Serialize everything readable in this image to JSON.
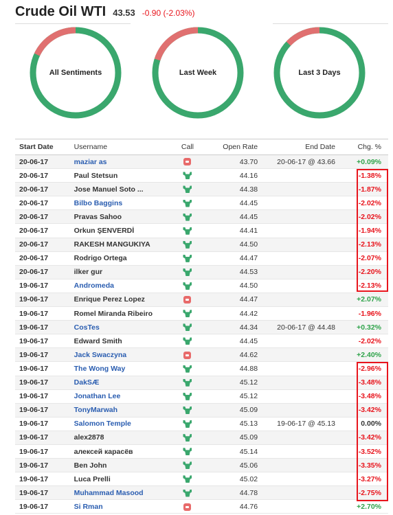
{
  "header": {
    "title": "Crude Oil WTI",
    "price": "43.53",
    "change": "-0.90 (-2.03%)"
  },
  "colors": {
    "bullish": "#3aa76d",
    "bearish": "#e07070",
    "negative": "#e8141c",
    "positive": "#2fa34a",
    "link": "#2a5db0"
  },
  "gauges": [
    {
      "label": "All Sentiments",
      "bearish_fraction": 0.18
    },
    {
      "label": "Last Week",
      "bearish_fraction": 0.2
    },
    {
      "label": "Last 3 Days",
      "bearish_fraction": 0.13
    }
  ],
  "table": {
    "headers": [
      "Start Date",
      "Username",
      "Call",
      "Open Rate",
      "End Date",
      "Chg. %"
    ],
    "rows": [
      {
        "date": "20-06-17",
        "user": "maziar as",
        "link": true,
        "call": "bearish",
        "rate": "43.70",
        "end": "20-06-17 @ 43.66",
        "chg": "+0.09%",
        "dir": "pos"
      },
      {
        "date": "20-06-17",
        "user": "Paul Stetsun",
        "link": false,
        "call": "bullish",
        "rate": "44.16",
        "end": "",
        "chg": "-1.38%",
        "dir": "neg"
      },
      {
        "date": "20-06-17",
        "user": "Jose Manuel Soto ...",
        "link": false,
        "call": "bullish",
        "rate": "44.38",
        "end": "",
        "chg": "-1.87%",
        "dir": "neg"
      },
      {
        "date": "20-06-17",
        "user": "Bilbo Baggins",
        "link": true,
        "call": "bullish",
        "rate": "44.45",
        "end": "",
        "chg": "-2.02%",
        "dir": "neg"
      },
      {
        "date": "20-06-17",
        "user": "Pravas Sahoo",
        "link": false,
        "call": "bullish",
        "rate": "44.45",
        "end": "",
        "chg": "-2.02%",
        "dir": "neg"
      },
      {
        "date": "20-06-17",
        "user": "Orkun ŞENVERDİ",
        "link": false,
        "call": "bullish",
        "rate": "44.41",
        "end": "",
        "chg": "-1.94%",
        "dir": "neg"
      },
      {
        "date": "20-06-17",
        "user": "RAKESH MANGUKIYA",
        "link": false,
        "call": "bullish",
        "rate": "44.50",
        "end": "",
        "chg": "-2.13%",
        "dir": "neg"
      },
      {
        "date": "20-06-17",
        "user": "Rodrigo Ortega",
        "link": false,
        "call": "bullish",
        "rate": "44.47",
        "end": "",
        "chg": "-2.07%",
        "dir": "neg"
      },
      {
        "date": "20-06-17",
        "user": "ilker gur",
        "link": false,
        "call": "bullish",
        "rate": "44.53",
        "end": "",
        "chg": "-2.20%",
        "dir": "neg"
      },
      {
        "date": "19-06-17",
        "user": "Andromeda",
        "link": true,
        "call": "bullish",
        "rate": "44.50",
        "end": "",
        "chg": "-2.13%",
        "dir": "neg"
      },
      {
        "date": "19-06-17",
        "user": "Enrique Perez Lopez",
        "link": false,
        "call": "bearish",
        "rate": "44.47",
        "end": "",
        "chg": "+2.07%",
        "dir": "pos"
      },
      {
        "date": "19-06-17",
        "user": "Romel Miranda Ribeiro",
        "link": false,
        "call": "bullish",
        "rate": "44.42",
        "end": "",
        "chg": "-1.96%",
        "dir": "neg"
      },
      {
        "date": "19-06-17",
        "user": "CosTes",
        "link": true,
        "call": "bullish",
        "rate": "44.34",
        "end": "20-06-17 @ 44.48",
        "chg": "+0.32%",
        "dir": "pos"
      },
      {
        "date": "19-06-17",
        "user": "Edward Smith",
        "link": false,
        "call": "bullish",
        "rate": "44.45",
        "end": "",
        "chg": "-2.02%",
        "dir": "neg"
      },
      {
        "date": "19-06-17",
        "user": "Jack Swaczyna",
        "link": true,
        "call": "bearish",
        "rate": "44.62",
        "end": "",
        "chg": "+2.40%",
        "dir": "pos"
      },
      {
        "date": "19-06-17",
        "user": "The Wong Way",
        "link": true,
        "call": "bullish",
        "rate": "44.88",
        "end": "",
        "chg": "-2.96%",
        "dir": "neg"
      },
      {
        "date": "19-06-17",
        "user": "DakSÆ",
        "link": true,
        "call": "bullish",
        "rate": "45.12",
        "end": "",
        "chg": "-3.48%",
        "dir": "neg"
      },
      {
        "date": "19-06-17",
        "user": "Jonathan Lee",
        "link": true,
        "call": "bullish",
        "rate": "45.12",
        "end": "",
        "chg": "-3.48%",
        "dir": "neg"
      },
      {
        "date": "19-06-17",
        "user": "TonyMarwah",
        "link": true,
        "call": "bullish",
        "rate": "45.09",
        "end": "",
        "chg": "-3.42%",
        "dir": "neg"
      },
      {
        "date": "19-06-17",
        "user": "Salomon Temple",
        "link": true,
        "call": "bullish",
        "rate": "45.13",
        "end": "19-06-17 @ 45.13",
        "chg": "0.00%",
        "dir": "zero"
      },
      {
        "date": "19-06-17",
        "user": "alex2878",
        "link": false,
        "call": "bullish",
        "rate": "45.09",
        "end": "",
        "chg": "-3.42%",
        "dir": "neg"
      },
      {
        "date": "19-06-17",
        "user": "алексей карасёв",
        "link": false,
        "call": "bullish",
        "rate": "45.14",
        "end": "",
        "chg": "-3.52%",
        "dir": "neg"
      },
      {
        "date": "19-06-17",
        "user": "Ben John",
        "link": false,
        "call": "bullish",
        "rate": "45.06",
        "end": "",
        "chg": "-3.35%",
        "dir": "neg"
      },
      {
        "date": "19-06-17",
        "user": "Luca Prelli",
        "link": false,
        "call": "bullish",
        "rate": "45.02",
        "end": "",
        "chg": "-3.27%",
        "dir": "neg"
      },
      {
        "date": "19-06-17",
        "user": "Muhammad Masood",
        "link": true,
        "call": "bullish",
        "rate": "44.78",
        "end": "",
        "chg": "-2.75%",
        "dir": "neg"
      },
      {
        "date": "19-06-17",
        "user": "Si Rman",
        "link": true,
        "call": "bearish",
        "rate": "44.76",
        "end": "",
        "chg": "+2.70%",
        "dir": "pos"
      }
    ]
  }
}
